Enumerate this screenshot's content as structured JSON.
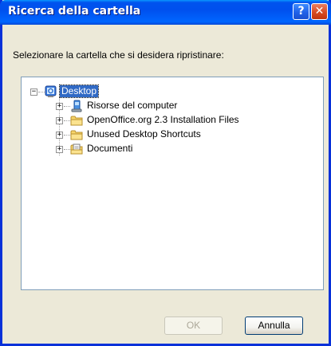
{
  "window": {
    "title": "Ricerca della cartella",
    "help_glyph": "?",
    "close_glyph": "✕"
  },
  "instruction": "Selezionare la cartella che si desidera ripristinare:",
  "tree": {
    "root": {
      "label": "Desktop",
      "expander": "−",
      "icon": "desktop-icon",
      "selected": true
    },
    "children": [
      {
        "label": "Risorse del computer",
        "expander": "+",
        "icon": "computer-icon"
      },
      {
        "label": "OpenOffice.org 2.3 Installation Files",
        "expander": "+",
        "icon": "folder-icon"
      },
      {
        "label": "Unused Desktop Shortcuts",
        "expander": "+",
        "icon": "folder-icon"
      },
      {
        "label": "Documenti",
        "expander": "+",
        "icon": "documents-icon"
      }
    ]
  },
  "buttons": {
    "ok": "OK",
    "cancel": "Annulla"
  },
  "colors": {
    "titlebar": "#0053ee",
    "selection": "#316ac5",
    "dialog_bg": "#ece9d8"
  }
}
